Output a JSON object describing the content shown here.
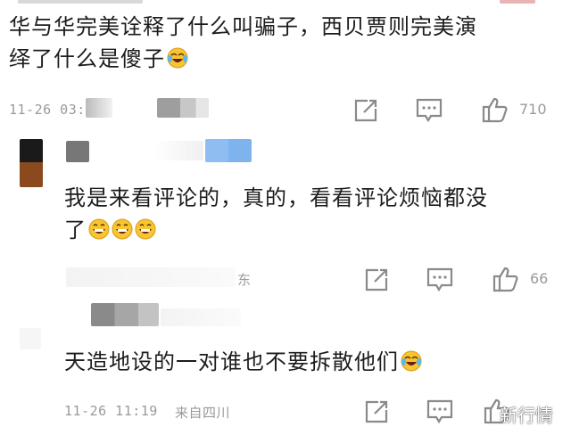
{
  "comment1": {
    "text_line1": "华与华完美诠释了什么叫骗子，西贝贾则完美演",
    "text_line2": "绎了什么是傻子",
    "timestamp": "11-26 03:",
    "likes": "710",
    "emoji": "laugh-cry-icon"
  },
  "reply1": {
    "text_line1": "我是来看评论的，真的，看看评论烦恼都没",
    "text_line2": "了",
    "location_fragment": "东",
    "likes": "66",
    "emoji": "grin-icon"
  },
  "reply2": {
    "text": "天造地设的一对谁也不要拆散他们",
    "timestamp": "11-26 11:19",
    "location": "来自四川",
    "emoji": "laugh-cry-icon"
  },
  "watermark": "新行情",
  "colors": {
    "text": "#1c1c1c",
    "meta": "#9a9a9a",
    "icon": "#8a8a8a",
    "blur_blue": "#7fb3ee",
    "avatar_brown": "#8a4a1e"
  }
}
